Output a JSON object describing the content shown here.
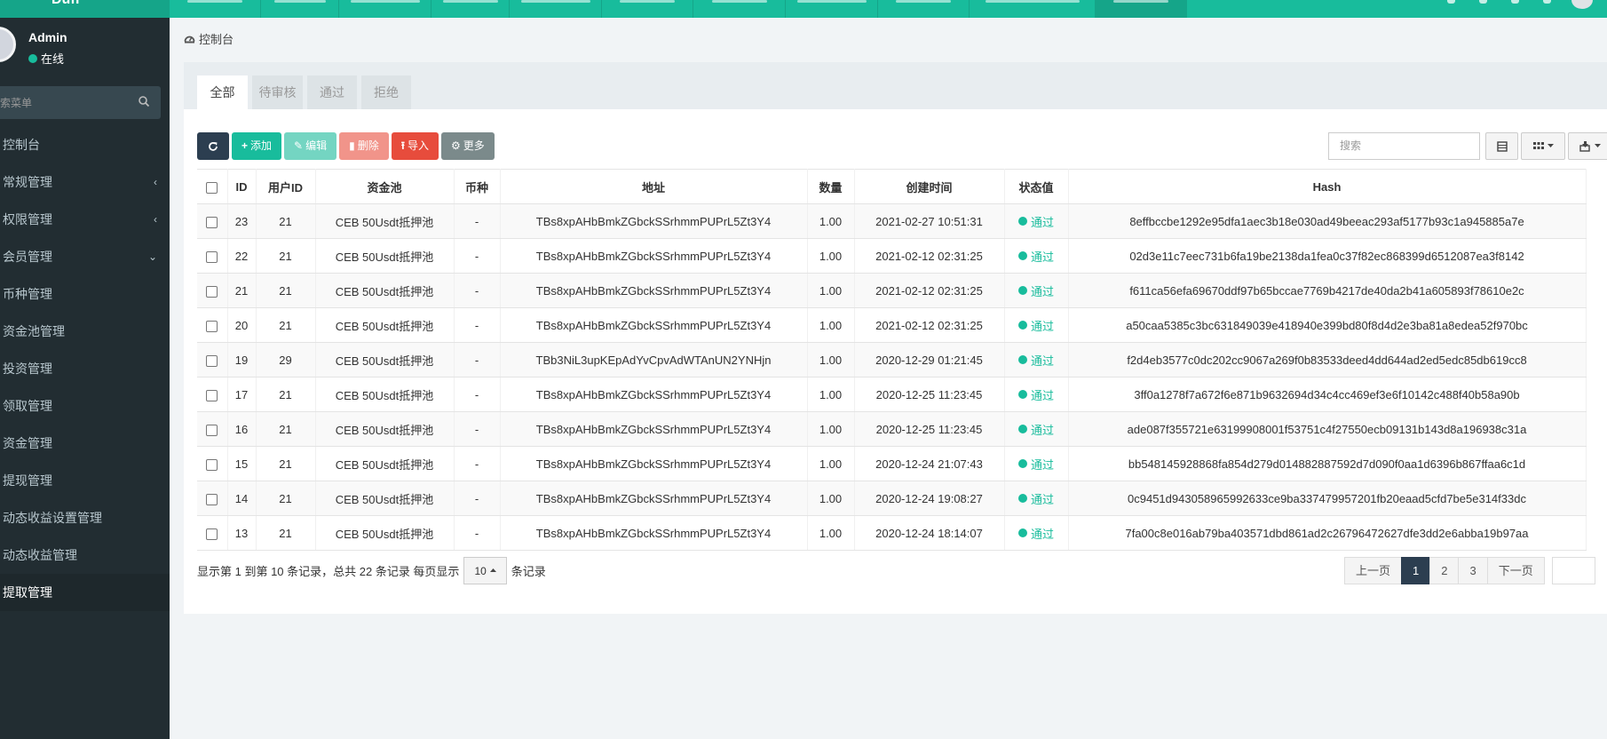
{
  "brand": {
    "title": "Duff"
  },
  "user": {
    "name": "Admin",
    "status": "在线"
  },
  "sidebar": {
    "search_placeholder": "搜索菜单",
    "items": [
      {
        "label": "控制台",
        "chevron": ""
      },
      {
        "label": "常规管理",
        "chevron": "‹"
      },
      {
        "label": "权限管理",
        "chevron": "‹"
      },
      {
        "label": "会员管理",
        "chevron": "⌄"
      },
      {
        "label": "币种管理",
        "chevron": ""
      },
      {
        "label": "资金池管理",
        "chevron": ""
      },
      {
        "label": "投资管理",
        "chevron": ""
      },
      {
        "label": "领取管理",
        "chevron": ""
      },
      {
        "label": "资金管理",
        "chevron": ""
      },
      {
        "label": "提现管理",
        "chevron": ""
      },
      {
        "label": "动态收益设置管理",
        "chevron": ""
      },
      {
        "label": "动态收益管理",
        "chevron": ""
      },
      {
        "label": "提取管理",
        "chevron": ""
      }
    ]
  },
  "breadcrumb": {
    "label": "控制台"
  },
  "tabs": [
    "全部",
    "待审核",
    "通过",
    "拒绝"
  ],
  "toolbar": {
    "add": "添加",
    "edit": "编辑",
    "delete": "删除",
    "import": "导入",
    "more": "更多"
  },
  "search": {
    "placeholder": "搜索"
  },
  "table": {
    "headers": [
      "ID",
      "用户ID",
      "资金池",
      "币种",
      "地址",
      "数量",
      "创建时间",
      "状态值",
      "Hash"
    ],
    "rows": [
      [
        "23",
        "21",
        "CEB 50Usdt抵押池",
        "-",
        "TBs8xpAHbBmkZGbckSSrhmmPUPrL5Zt3Y4",
        "1.00",
        "2021-02-27 10:51:31",
        "通过",
        "8effbccbe1292e95dfa1aec3b18e030ad49beeac293af5177b93c1a945885a7e"
      ],
      [
        "22",
        "21",
        "CEB 50Usdt抵押池",
        "-",
        "TBs8xpAHbBmkZGbckSSrhmmPUPrL5Zt3Y4",
        "1.00",
        "2021-02-12 02:31:25",
        "通过",
        "02d3e11c7eec731b6fa19be2138da1fea0c37f82ec868399d6512087ea3f8142"
      ],
      [
        "21",
        "21",
        "CEB 50Usdt抵押池",
        "-",
        "TBs8xpAHbBmkZGbckSSrhmmPUPrL5Zt3Y4",
        "1.00",
        "2021-02-12 02:31:25",
        "通过",
        "f611ca56efa69670ddf97b65bccae7769b4217de40da2b41a605893f78610e2c"
      ],
      [
        "20",
        "21",
        "CEB 50Usdt抵押池",
        "-",
        "TBs8xpAHbBmkZGbckSSrhmmPUPrL5Zt3Y4",
        "1.00",
        "2021-02-12 02:31:25",
        "通过",
        "a50caa5385c3bc631849039e418940e399bd80f8d4d2e3ba81a8edea52f970bc"
      ],
      [
        "19",
        "29",
        "CEB 50Usdt抵押池",
        "-",
        "TBb3NiL3upKEpAdYvCpvAdWTAnUN2YNHjn",
        "1.00",
        "2020-12-29 01:21:45",
        "通过",
        "f2d4eb3577c0dc202cc9067a269f0b83533deed4dd644ad2ed5edc85db619cc8"
      ],
      [
        "17",
        "21",
        "CEB 50Usdt抵押池",
        "-",
        "TBs8xpAHbBmkZGbckSSrhmmPUPrL5Zt3Y4",
        "1.00",
        "2020-12-25 11:23:45",
        "通过",
        "3ff0a1278f7a672f6e871b9632694d34c4cc469ef3e6f10142c488f40b58a90b"
      ],
      [
        "16",
        "21",
        "CEB 50Usdt抵押池",
        "-",
        "TBs8xpAHbBmkZGbckSSrhmmPUPrL5Zt3Y4",
        "1.00",
        "2020-12-25 11:23:45",
        "通过",
        "ade087f355721e63199908001f53751c4f27550ecb09131b143d8a196938c31a"
      ],
      [
        "15",
        "21",
        "CEB 50Usdt抵押池",
        "-",
        "TBs8xpAHbBmkZGbckSSrhmmPUPrL5Zt3Y4",
        "1.00",
        "2020-12-24 21:07:43",
        "通过",
        "bb548145928868fa854d279d014882887592d7d090f0aa1d6396b867ffaa6c1d"
      ],
      [
        "14",
        "21",
        "CEB 50Usdt抵押池",
        "-",
        "TBs8xpAHbBmkZGbckSSrhmmPUPrL5Zt3Y4",
        "1.00",
        "2020-12-24 19:08:27",
        "通过",
        "0c9451d943058965992633ce9ba337479957201fb20eaad5cfd7be5e314f33dc"
      ],
      [
        "13",
        "21",
        "CEB 50Usdt抵押池",
        "-",
        "TBs8xpAHbBmkZGbckSSrhmmPUPrL5Zt3Y4",
        "1.00",
        "2020-12-24 18:14:07",
        "通过",
        "7fa00c8e016ab79ba403571dbd861ad2c26796472627dfe3dd2e6abba19b97aa"
      ]
    ]
  },
  "pagination": {
    "info_prefix": "显示第 1 到第 10 条记录，总共 22 条记录 每页显示",
    "page_size": "10",
    "info_suffix": "条记录",
    "prev": "上一页",
    "pages": [
      "1",
      "2",
      "3"
    ],
    "current_page": "1",
    "next": "下一页"
  },
  "colors": {
    "accent": "#18bc9c",
    "sidebar": "#222d32",
    "dark": "#2c3e50",
    "danger": "#e74c3c"
  }
}
